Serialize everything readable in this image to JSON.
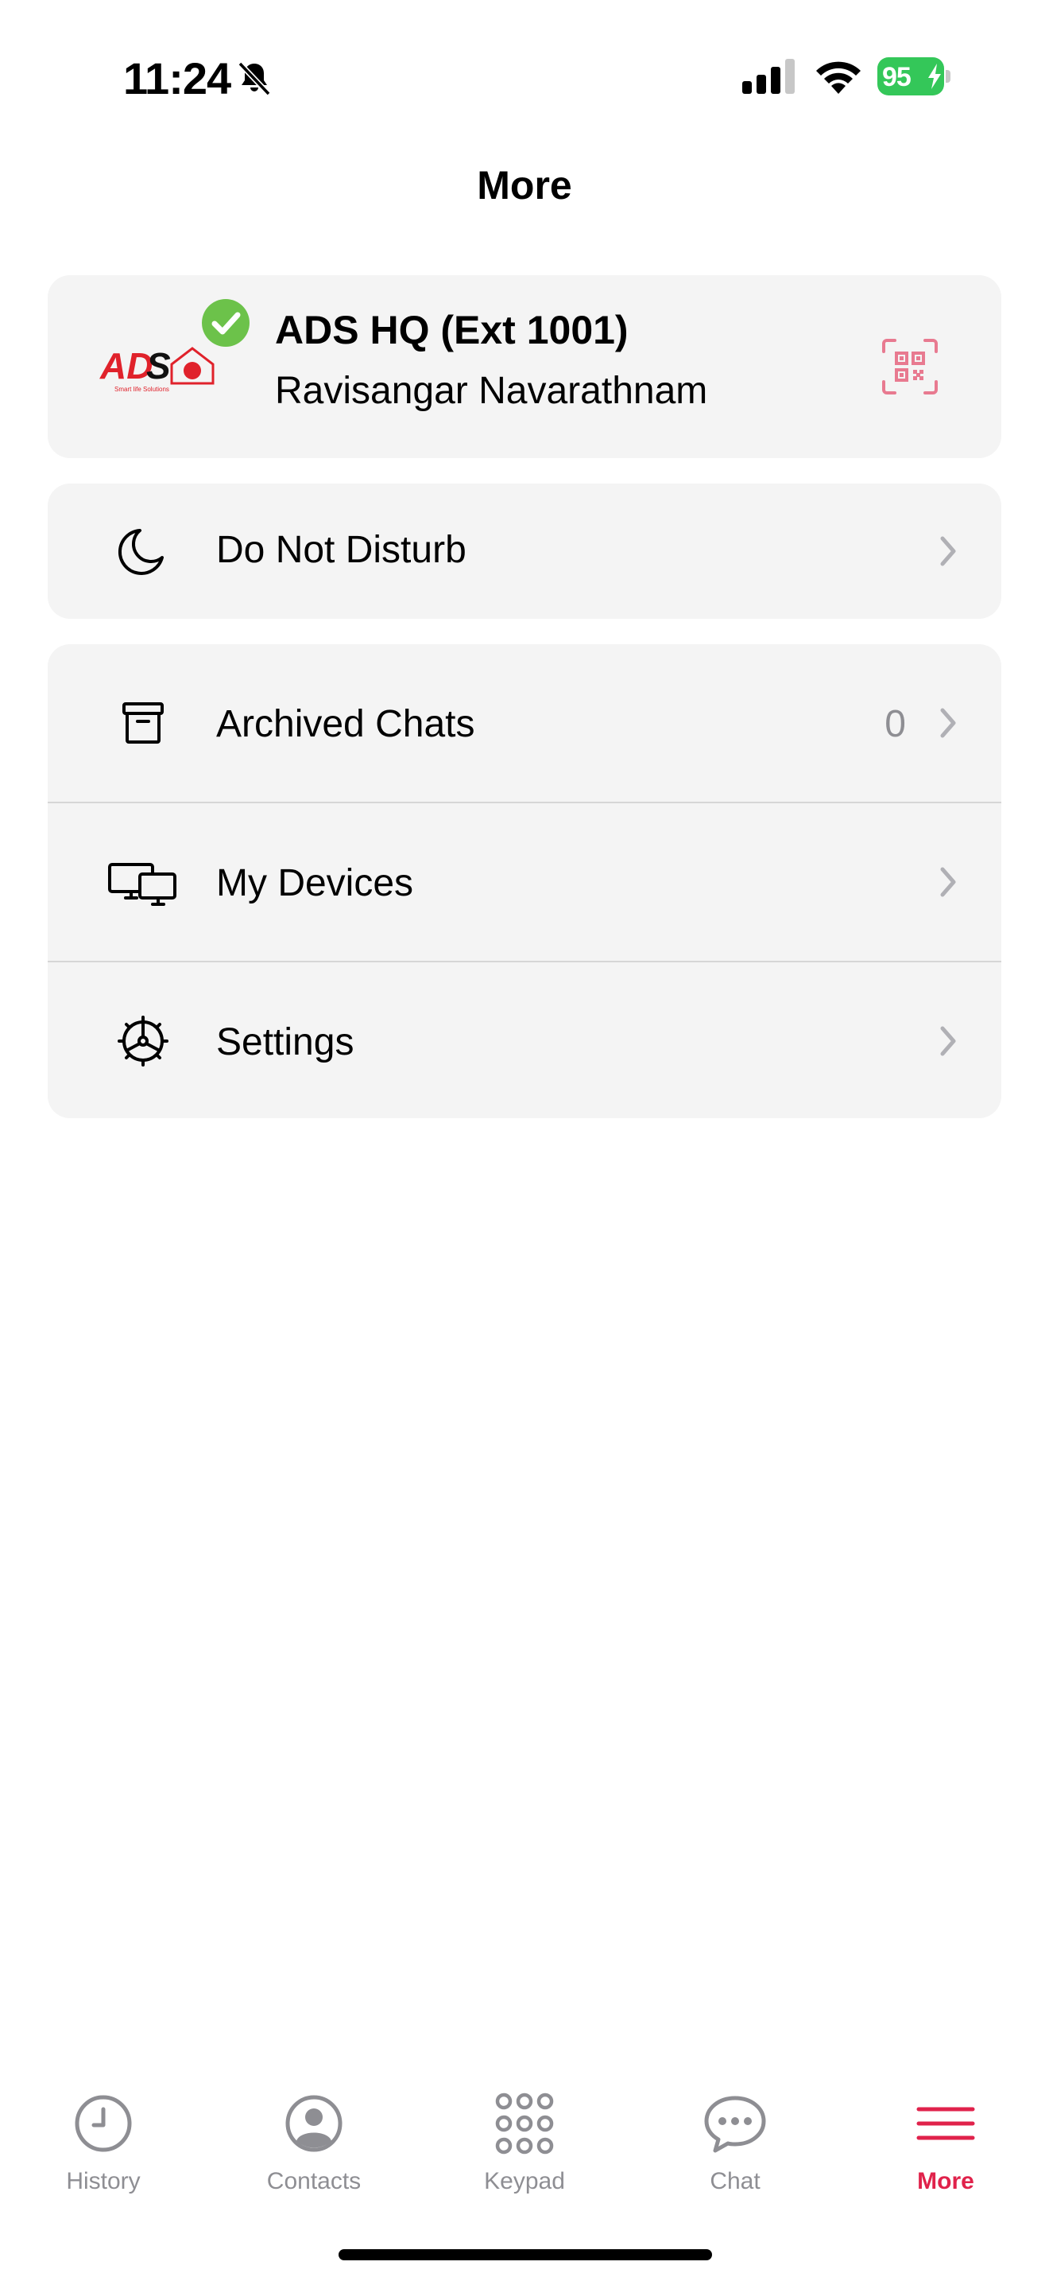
{
  "status_bar": {
    "time": "11:24",
    "battery_level": "95",
    "battery_color": "#34c759",
    "icons": [
      "bell-slash-icon",
      "signal-icon",
      "wifi-icon",
      "battery-charging-icon"
    ]
  },
  "page": {
    "title": "More"
  },
  "profile": {
    "name": "ADS HQ (Ext 1001)",
    "user": "Ravisangar Navarathnam",
    "status": "online",
    "status_color": "#6cc24a",
    "logo_text": "ADS",
    "logo_tagline": "Smart life Solutions",
    "qr_icon": "qr-code-icon"
  },
  "dnd": {
    "label": "Do Not Disturb",
    "icon": "moon-icon"
  },
  "menu": {
    "archived": {
      "label": "Archived Chats",
      "count": "0",
      "icon": "archive-box-icon"
    },
    "devices": {
      "label": "My Devices",
      "icon": "devices-icon"
    },
    "settings": {
      "label": "Settings",
      "icon": "gear-icon"
    }
  },
  "tabs": [
    {
      "label": "History",
      "icon": "clock-icon",
      "active": false
    },
    {
      "label": "Contacts",
      "icon": "person-circle-icon",
      "active": false
    },
    {
      "label": "Keypad",
      "icon": "keypad-icon",
      "active": false
    },
    {
      "label": "Chat",
      "icon": "chat-bubble-icon",
      "active": false
    },
    {
      "label": "More",
      "icon": "hamburger-icon",
      "active": true
    }
  ],
  "colors": {
    "accent": "#e0224b",
    "inactive": "#8e8e93",
    "card": "#f4f4f4"
  }
}
